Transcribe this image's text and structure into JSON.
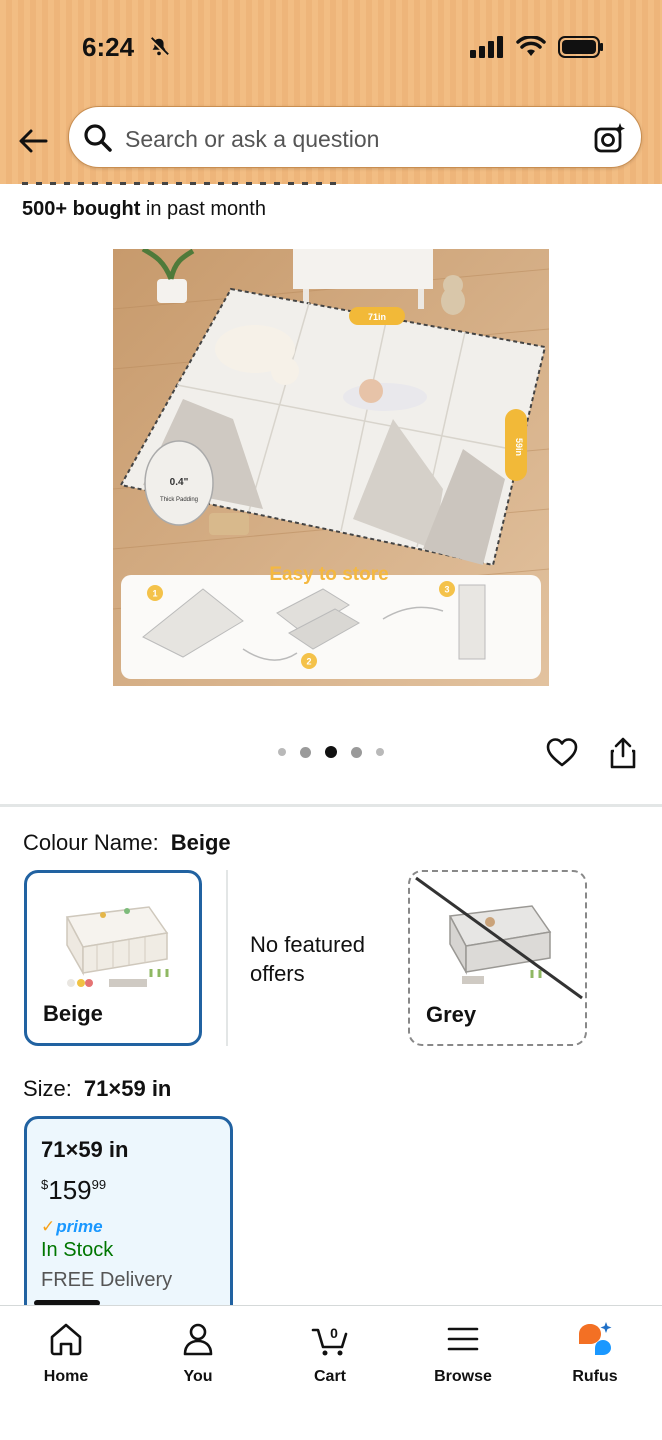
{
  "status_bar": {
    "time": "6:24"
  },
  "search": {
    "placeholder": "Search or ask a question"
  },
  "product": {
    "bought_bold": "500+ bought",
    "bought_rest": " in past month",
    "image_overlay_text": "Easy to store",
    "image_step_numbers": [
      "1",
      "2",
      "3"
    ],
    "image_dim_top": "71in",
    "image_dim_side": "59in",
    "image_padding_value": "0.4\"",
    "image_padding_text": "Thick Padding",
    "carousel_total": 5,
    "carousel_active": 3
  },
  "colour": {
    "label": "Colour Name:",
    "value": "Beige",
    "options": [
      {
        "name": "Beige",
        "selected": true
      },
      {
        "name": "Grey",
        "selected": false
      }
    ],
    "no_offers": "No featured offers"
  },
  "size": {
    "label": "Size:",
    "value": "71×59 in",
    "card": {
      "size": "71×59 in",
      "currency": "$",
      "price_whole": "159",
      "price_fraction": "99",
      "prime": "prime",
      "stock": "In Stock",
      "delivery": "FREE Delivery"
    }
  },
  "bottom_nav": {
    "cart_count": "0",
    "items": [
      {
        "label": "Home",
        "icon": "home-icon"
      },
      {
        "label": "You",
        "icon": "person-icon"
      },
      {
        "label": "Cart",
        "icon": "cart-icon"
      },
      {
        "label": "Browse",
        "icon": "menu-icon"
      },
      {
        "label": "Rufus",
        "icon": "rufus-icon"
      }
    ]
  },
  "colors": {
    "header_bg": "#f2bd83",
    "selected_border": "#2162a1",
    "in_stock": "#007600",
    "prime": "#1a98ff"
  }
}
